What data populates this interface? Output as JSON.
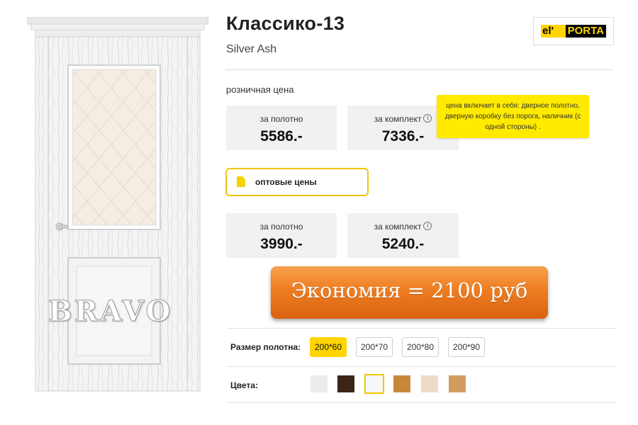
{
  "product": {
    "title": "Классико-13",
    "subtitle": "Silver Ash",
    "brand": {
      "part1": "el'",
      "part2": "PORTA"
    },
    "watermark": "BRAVO"
  },
  "retail": {
    "label": "розничная цена",
    "blade_label": "за полотно",
    "blade_price": "5586.-",
    "set_label": "за комплект",
    "set_price": "7336.-"
  },
  "tooltip": {
    "text": "цена включает в себя: дверное полотно, дверную коробку без порога, наличник (с одной стороны) ."
  },
  "wholesale": {
    "button_label": "оптовые цены",
    "blade_label": "за полотно",
    "blade_price": "3990.-",
    "set_label": "за комплект",
    "set_price": "5240.-"
  },
  "savings": {
    "text": "Экономия = 2100 руб"
  },
  "sizes": {
    "label": "Размер полотна:",
    "options": [
      "200*60",
      "200*70",
      "200*80",
      "200*90"
    ],
    "selected": "200*60"
  },
  "colors": {
    "label": "Цвета:",
    "swatches": [
      "#ececec",
      "#3b2418",
      "#f7f7f7",
      "#c9873c",
      "#ecdcc6",
      "#d39c5e"
    ],
    "selected_index": 2
  },
  "icons": {
    "info": "info-icon",
    "document": "document-icon"
  }
}
